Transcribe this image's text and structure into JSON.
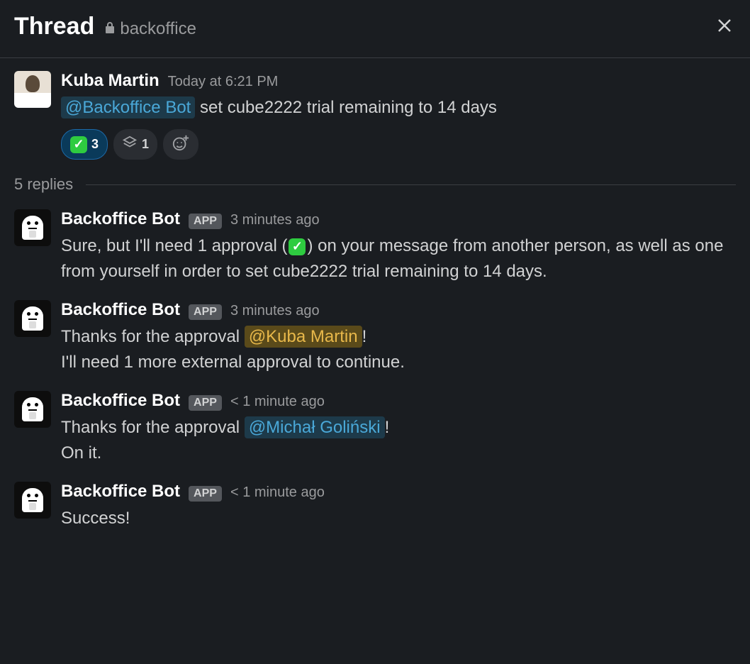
{
  "header": {
    "title": "Thread",
    "channel": "backoffice"
  },
  "original": {
    "author": "Kuba Martin",
    "timestamp": "Today at 6:21 PM",
    "mention": "@Backoffice Bot",
    "text_rest": " set cube2222 trial remaining to 14 days",
    "reactions": {
      "check_count": "3",
      "stack_count": "1"
    }
  },
  "replies_label": "5 replies",
  "replies": [
    {
      "author": "Backoffice Bot",
      "app_badge": "APP",
      "timestamp": "3 minutes ago",
      "text_before": "Sure, but I'll need 1 approval (",
      "text_after": ") on your message from another person, as well as one from yourself in order to set cube2222 trial remaining to 14 days."
    },
    {
      "author": "Backoffice Bot",
      "app_badge": "APP",
      "timestamp": "3 minutes ago",
      "line1_prefix": "Thanks for the approval ",
      "line1_mention": "@Kuba Martin",
      "line1_suffix": "!",
      "line2": "I'll need 1 more external approval to continue."
    },
    {
      "author": "Backoffice Bot",
      "app_badge": "APP",
      "timestamp": "< 1 minute ago",
      "line1_prefix": "Thanks for the approval ",
      "line1_mention": "@Michał Goliński",
      "line1_suffix": "!",
      "line2": "On it."
    },
    {
      "author": "Backoffice Bot",
      "app_badge": "APP",
      "timestamp": "< 1 minute ago",
      "text": "Success!"
    }
  ]
}
